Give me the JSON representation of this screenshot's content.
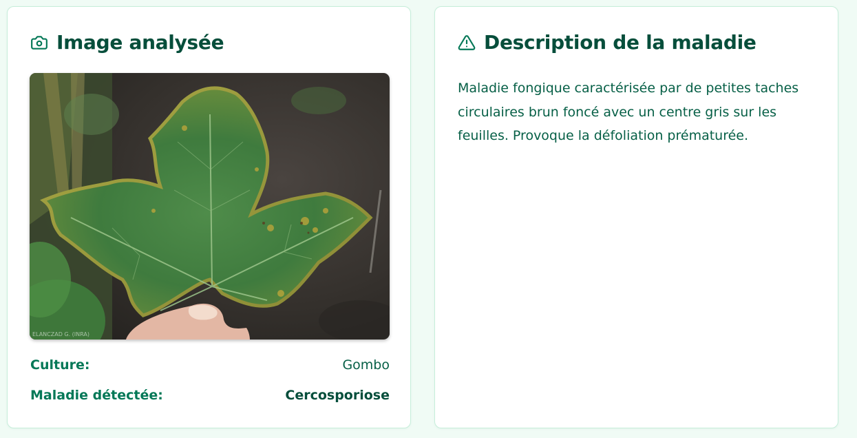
{
  "left_card": {
    "title": "Image analysée",
    "icon": "camera-icon",
    "image_watermark": "ELANCZAD G. (INRA)",
    "culture_label": "Culture:",
    "culture_value": "Gombo",
    "disease_label": "Maladie détectée:",
    "disease_value": "Cercosporiose"
  },
  "right_card": {
    "title": "Description de la maladie",
    "icon": "warning-triangle-icon",
    "description": "Maladie fongique caractérisée par de petites taches circulaires brun foncé avec un centre gris sur les feuilles. Provoque la défoliation prématurée."
  },
  "colors": {
    "page_background": "#f0fbf5",
    "card_border": "#c6eeda",
    "title_text": "#064e3b",
    "label_text": "#047857",
    "body_text": "#065f46"
  }
}
